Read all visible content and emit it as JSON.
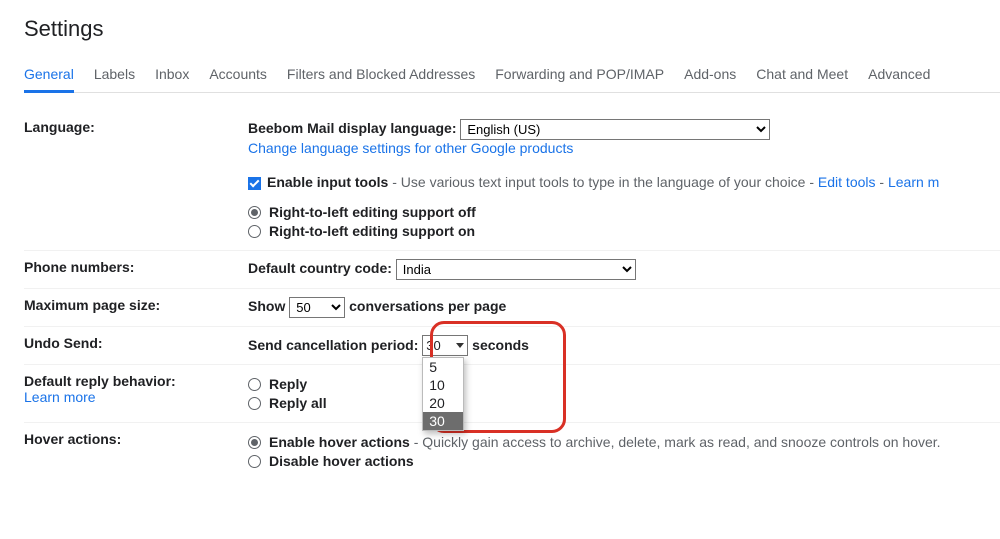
{
  "title": "Settings",
  "tabs": {
    "general": "General",
    "labels": "Labels",
    "inbox": "Inbox",
    "accounts": "Accounts",
    "filters": "Filters and Blocked Addresses",
    "forwarding": "Forwarding and POP/IMAP",
    "addons": "Add-ons",
    "chat": "Chat and Meet",
    "advanced": "Advanced"
  },
  "language": {
    "label": "Language:",
    "display_language_label": "Beebom Mail display language:",
    "display_language_value": "English (US)",
    "change_link": "Change language settings for other Google products",
    "enable_input_label": "Enable input tools",
    "enable_input_desc": " - Use various text input tools to type in the language of your choice - ",
    "edit_tools": "Edit tools",
    "dash": " - ",
    "learn_more": "Learn m",
    "rtl_off": "Right-to-left editing support off",
    "rtl_on": "Right-to-left editing support on"
  },
  "phone": {
    "label": "Phone numbers:",
    "default_code_label": "Default country code:",
    "default_code_value": "India"
  },
  "page_size": {
    "label": "Maximum page size:",
    "show": "Show",
    "value": "50",
    "suffix": "conversations per page"
  },
  "undo_send": {
    "label": "Undo Send:",
    "prefix": "Send cancellation period:",
    "value": "30",
    "suffix": "seconds",
    "options": {
      "o1": "5",
      "o2": "10",
      "o3": "20",
      "o4": "30"
    }
  },
  "reply": {
    "label": "Default reply behavior:",
    "learn_more": "Learn more",
    "reply": "Reply",
    "reply_all": "Reply all"
  },
  "hover": {
    "label": "Hover actions:",
    "enable": "Enable hover actions",
    "enable_desc": " - Quickly gain access to archive, delete, mark as read, and snooze controls on hover.",
    "disable": "Disable hover actions"
  }
}
